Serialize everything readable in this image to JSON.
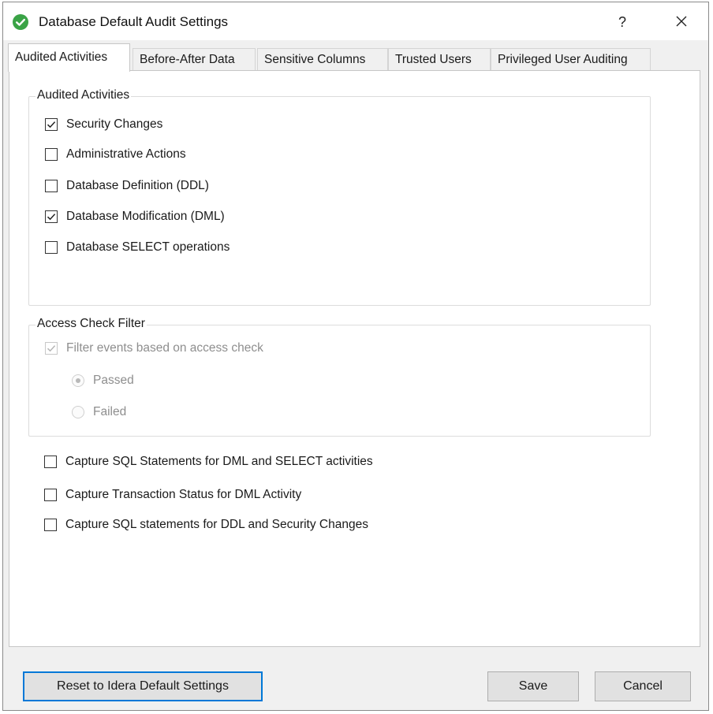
{
  "window": {
    "title": "Database Default Audit Settings",
    "help_label": "?",
    "accent_color": "#0078d7",
    "app_icon": "check-circle-icon",
    "app_icon_color": "#3aa346"
  },
  "tabs": [
    {
      "label": "Audited Activities",
      "active": true
    },
    {
      "label": "Before-After Data",
      "active": false
    },
    {
      "label": "Sensitive Columns",
      "active": false
    },
    {
      "label": "Trusted Users",
      "active": false
    },
    {
      "label": "Privileged User Auditing",
      "active": false
    }
  ],
  "audited_activities": {
    "legend": "Audited Activities",
    "items": [
      {
        "label": "Security Changes",
        "checked": true
      },
      {
        "label": "Administrative Actions",
        "checked": false
      },
      {
        "label": "Database Definition (DDL)",
        "checked": false
      },
      {
        "label": "Database Modification (DML)",
        "checked": true
      },
      {
        "label": "Database SELECT operations",
        "checked": false
      }
    ]
  },
  "access_check": {
    "legend": "Access Check Filter",
    "filter_label": "Filter events based on access check",
    "filter_checked": true,
    "enabled": false,
    "options": [
      {
        "label": "Passed",
        "selected": true
      },
      {
        "label": "Failed",
        "selected": false
      }
    ]
  },
  "capture": [
    {
      "label": "Capture SQL Statements for DML and SELECT activities",
      "checked": false
    },
    {
      "label": "Capture Transaction Status for DML Activity",
      "checked": false
    },
    {
      "label": "Capture SQL statements for DDL and Security Changes",
      "checked": false
    }
  ],
  "buttons": {
    "reset": "Reset to Idera Default Settings",
    "save": "Save",
    "cancel": "Cancel"
  }
}
